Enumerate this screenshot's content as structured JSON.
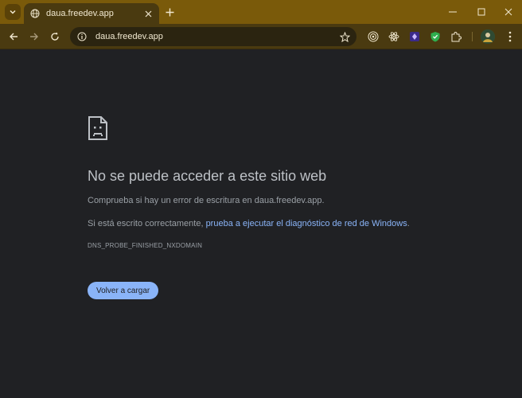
{
  "browser": {
    "tab": {
      "title": "daua.freedev.app"
    },
    "omnibox": {
      "url": "daua.freedev.app"
    }
  },
  "page": {
    "title": "No se puede acceder a este sitio web",
    "line1": "Comprueba si hay un error de escritura en daua.freedev.app.",
    "line2_prefix": "Si está escrito correctamente, ",
    "line2_link": "prueba a ejecutar el diagnóstico de red de Windows",
    "line2_suffix": ".",
    "error_code": "DNS_PROBE_FINISHED_NXDOMAIN",
    "reload_label": "Volver a cargar"
  },
  "colors": {
    "frame": "#7a5a0a",
    "toolbar": "#4a3a10",
    "page_bg": "#202124",
    "link": "#8ab4f8",
    "button": "#8ab4f8"
  },
  "icons": [
    "tab-search-icon",
    "globe-icon",
    "close-icon",
    "plus-icon",
    "minimize-icon",
    "maximize-icon",
    "window-close-icon",
    "back-icon",
    "forward-icon",
    "reload-icon",
    "info-icon",
    "star-icon",
    "extension-target-icon",
    "extension-react-icon",
    "extension-purple-icon",
    "extension-shield-icon",
    "puzzle-icon",
    "avatar",
    "menu-icon",
    "sad-page-icon"
  ]
}
